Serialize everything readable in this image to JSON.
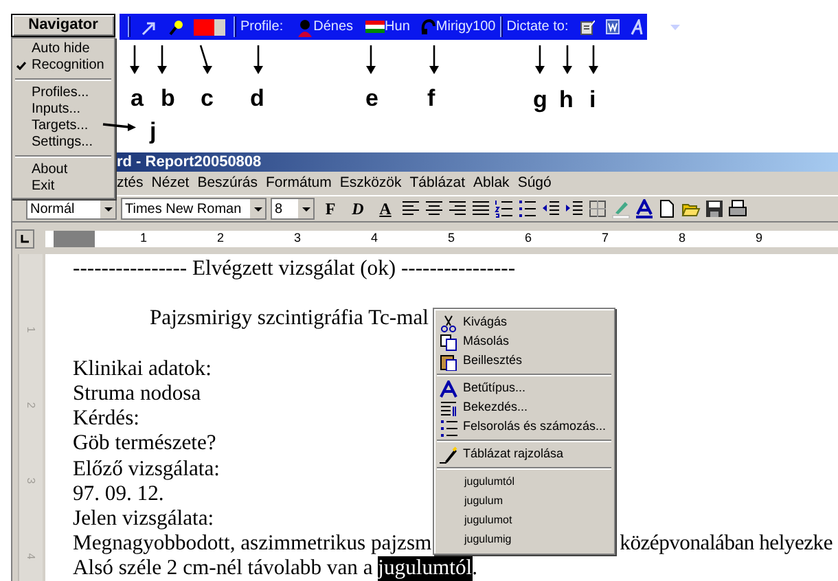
{
  "navigator": {
    "button": "Navigator",
    "menu": [
      {
        "kind": "item",
        "label": "Auto hide",
        "checked": false
      },
      {
        "kind": "item",
        "label": "Recognition",
        "checked": true
      },
      {
        "kind": "separator"
      },
      {
        "kind": "item",
        "label": "Profiles...",
        "checked": false
      },
      {
        "kind": "item",
        "label": "Inputs...",
        "checked": false
      },
      {
        "kind": "item",
        "label": "Targets...",
        "checked": false
      },
      {
        "kind": "item",
        "label": "Settings...",
        "checked": false
      },
      {
        "kind": "separator"
      },
      {
        "kind": "item",
        "label": "About",
        "checked": false
      },
      {
        "kind": "item",
        "label": "Exit",
        "checked": false
      }
    ]
  },
  "bar": {
    "profile_label": "Profile:",
    "user": "Dénes",
    "language": "Hun",
    "vocabulary": "Mirigy100",
    "dictate_label": "Dictate to:"
  },
  "annotations": [
    {
      "label": "a"
    },
    {
      "label": "b"
    },
    {
      "label": "c"
    },
    {
      "label": "d"
    },
    {
      "label": "e"
    },
    {
      "label": "f"
    },
    {
      "label": "g"
    },
    {
      "label": "h"
    },
    {
      "label": "i"
    },
    {
      "label": "j"
    }
  ],
  "word": {
    "title": "rd - Report20050808",
    "menus": [
      "ztés",
      "Nézet",
      "Beszúrás",
      "Formátum",
      "Eszközök",
      "Táblázat",
      "Ablak",
      "Súgó"
    ],
    "style": "Normál",
    "font": "Times New Roman",
    "size": "8",
    "format_buttons": [
      "F",
      "D",
      "A"
    ],
    "ruler": [
      "1",
      "2",
      "3",
      "4",
      "5",
      "6",
      "7",
      "8",
      "9"
    ],
    "vruler": [
      "1",
      "2",
      "3",
      "4"
    ],
    "lines": [
      {
        "kind": "plain",
        "parts": [
          {
            "text": "---------------- Elvégzett vizsgálat (ok) ----------------",
            "highlighted": false
          }
        ]
      },
      {
        "kind": "blank"
      },
      {
        "kind": "indented",
        "parts": [
          {
            "text": "Pajzsmirigy szcintigráfia Tc-mal",
            "highlighted": false
          }
        ]
      },
      {
        "kind": "blank"
      },
      {
        "kind": "plain",
        "parts": [
          {
            "text": "Klinikai adatok:",
            "highlighted": false
          }
        ]
      },
      {
        "kind": "plain",
        "parts": [
          {
            "text": "Struma nodosa",
            "highlighted": false
          }
        ]
      },
      {
        "kind": "plain",
        "parts": [
          {
            "text": "Kérdés:",
            "highlighted": false
          }
        ]
      },
      {
        "kind": "plain",
        "parts": [
          {
            "text": "Göb természete?",
            "highlighted": false
          }
        ]
      },
      {
        "kind": "plain",
        "parts": [
          {
            "text": "Előző vizsgálata:",
            "highlighted": false
          }
        ]
      },
      {
        "kind": "plain",
        "parts": [
          {
            "text": "97. 09. 12.",
            "highlighted": false
          }
        ]
      },
      {
        "kind": "plain",
        "parts": [
          {
            "text": "Jelen vizsgálata:",
            "highlighted": false
          }
        ]
      },
      {
        "kind": "plain",
        "parts": [
          {
            "text": "Megnagyobbodott, aszimmetrikus pajzsm",
            "highlighted": false
          },
          {
            "text": "középvonalában helyezke",
            "highlighted": false,
            "after_gap": true
          }
        ]
      },
      {
        "kind": "plain",
        "parts": [
          {
            "text": "Alsó széle 2 cm-nél távolabb van a ",
            "highlighted": false
          },
          {
            "text": "jugulumtól",
            "highlighted": true
          },
          {
            "text": ".",
            "highlighted": false
          }
        ]
      }
    ],
    "context_menu": [
      {
        "kind": "command",
        "label": "Kivágás"
      },
      {
        "kind": "command",
        "label": "Másolás"
      },
      {
        "kind": "command",
        "label": "Beillesztés"
      },
      {
        "kind": "separator"
      },
      {
        "kind": "command",
        "label": "Betűtípus..."
      },
      {
        "kind": "command",
        "label": "Bekezdés..."
      },
      {
        "kind": "command",
        "label": "Felsorolás és számozás..."
      },
      {
        "kind": "separator"
      },
      {
        "kind": "command",
        "label": "Táblázat rajzolása"
      },
      {
        "kind": "separator"
      },
      {
        "kind": "suggestion",
        "label": "jugulumtól"
      },
      {
        "kind": "suggestion",
        "label": "jugulum"
      },
      {
        "kind": "suggestion",
        "label": "jugulumot"
      },
      {
        "kind": "suggestion",
        "label": "jugulumig"
      }
    ]
  }
}
